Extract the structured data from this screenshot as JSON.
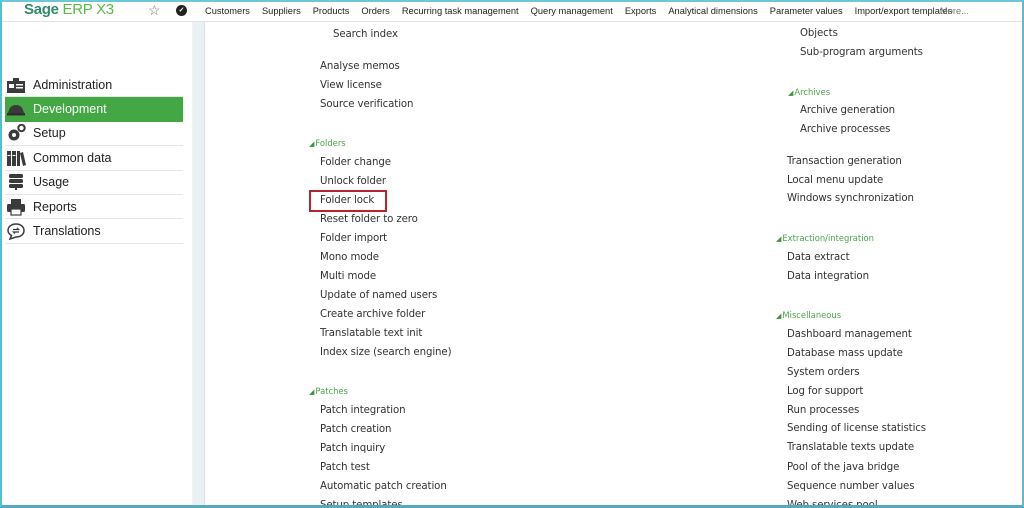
{
  "app": {
    "logo_brand": "Sage",
    "logo_product": "ERP X3",
    "icons": {
      "favorite": "star-icon",
      "menu": "check-circle-icon"
    }
  },
  "topnav": {
    "items": [
      "Customers",
      "Suppliers",
      "Products",
      "Orders",
      "Recurring task management",
      "Query management",
      "Exports",
      "Analytical dimensions",
      "Parameter values",
      "Import/export templates"
    ],
    "more": "More..."
  },
  "sidebar": {
    "active_color": "#43a843",
    "items": [
      {
        "label": "Administration",
        "icon": "administration-icon",
        "active": false
      },
      {
        "label": "Development",
        "icon": "development-icon",
        "active": true
      },
      {
        "label": "Setup",
        "icon": "gears-icon",
        "active": false
      },
      {
        "label": "Common data",
        "icon": "binders-icon",
        "active": false
      },
      {
        "label": "Usage",
        "icon": "server-icon",
        "active": false
      },
      {
        "label": "Reports",
        "icon": "printer-icon",
        "active": false
      },
      {
        "label": "Translations",
        "icon": "chat-translate-icon",
        "active": false
      }
    ]
  },
  "content": {
    "left_column": {
      "top_links": [
        "Search index",
        "Analyse memos",
        "View license",
        "Source verification"
      ],
      "folders": {
        "title": "Folders",
        "items": [
          "Folder change",
          "Unlock folder",
          "Folder lock",
          "Reset folder to zero",
          "Folder import",
          "Mono mode",
          "Multi mode",
          "Update of named users",
          "Create archive folder",
          "Translatable text init",
          "Index size (search engine)"
        ]
      },
      "patches": {
        "title": "Patches",
        "items": [
          "Patch integration",
          "Patch creation",
          "Patch inquiry",
          "Patch test",
          "Automatic patch creation",
          "Setup templates"
        ]
      },
      "highlighted_item": "Folder lock"
    },
    "right_column": {
      "top_links": [
        "Objects",
        "Sub-program arguments"
      ],
      "archives": {
        "title": "Archives",
        "items": [
          "Archive generation",
          "Archive processes"
        ]
      },
      "middle_links": [
        "Transaction generation",
        "Local menu update",
        "Windows synchronization"
      ],
      "extraction": {
        "title": "Extraction/integration",
        "items": [
          "Data extract",
          "Data integration"
        ]
      },
      "misc": {
        "title": "Miscellaneous",
        "items": [
          "Dashboard management",
          "Database mass update",
          "System orders",
          "Log for support",
          "Run processes",
          "Sending of license statistics",
          "Translatable texts update",
          "Pool of the java bridge",
          "Sequence number values",
          "Web services pool"
        ]
      }
    }
  }
}
